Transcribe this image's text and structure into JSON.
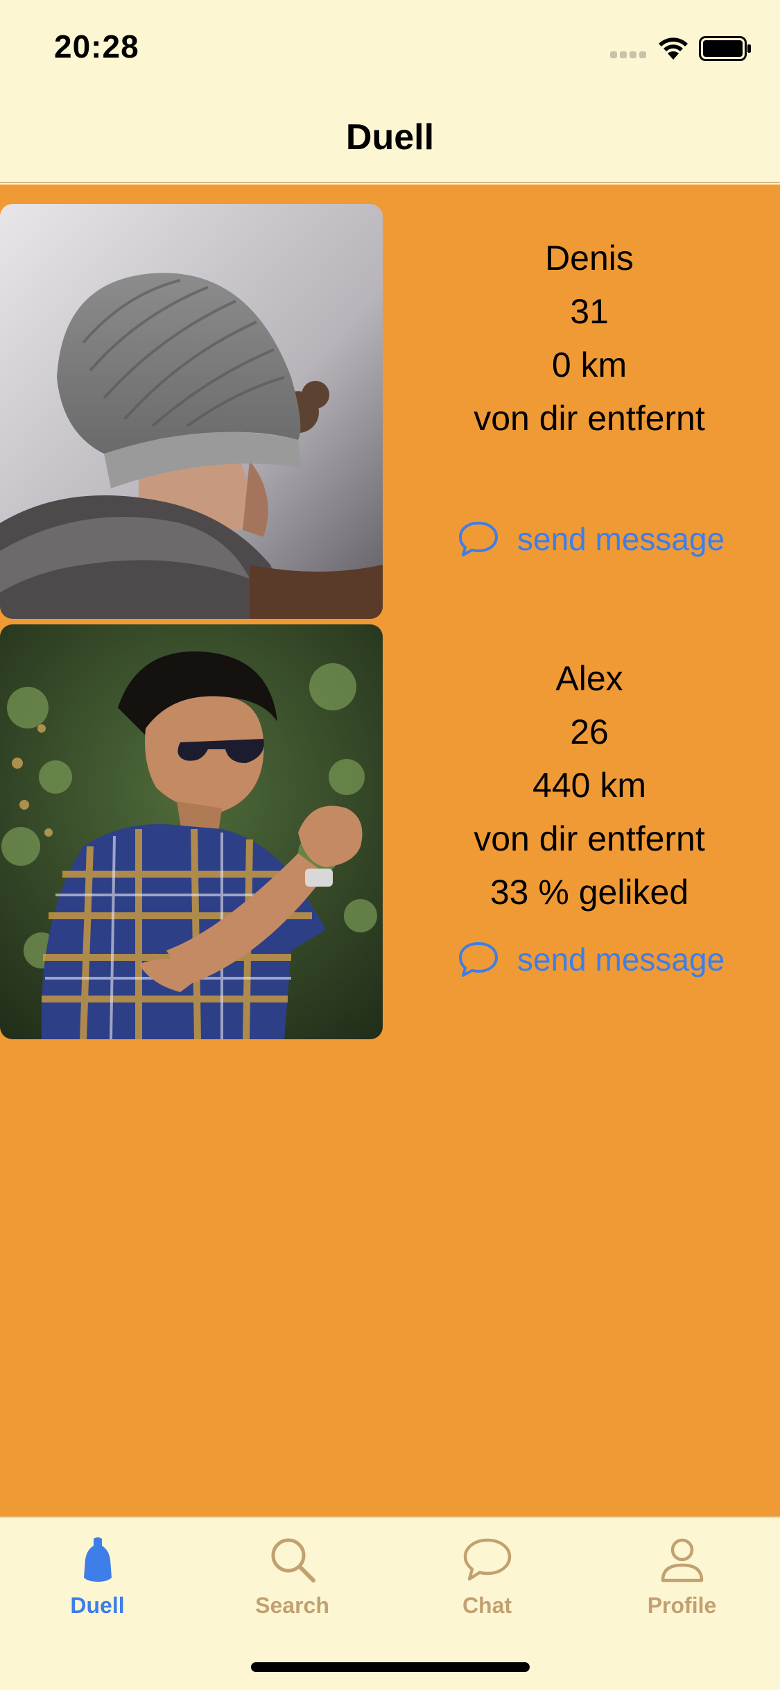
{
  "status_bar": {
    "time": "20:28"
  },
  "nav": {
    "title": "Duell"
  },
  "cards": [
    {
      "name": "Denis",
      "age": "31",
      "distance": "0 km",
      "distance_suffix": "von dir entfernt",
      "liked": "",
      "action_label": "send message",
      "action_icon": "chat-bubble-icon"
    },
    {
      "name": "Alex",
      "age": "26",
      "distance": "440 km",
      "distance_suffix": "von dir entfernt",
      "liked": "33 % geliked",
      "action_label": "send message",
      "action_icon": "chat-bubble-icon"
    }
  ],
  "tabs": [
    {
      "label": "Duell",
      "icon": "duell-figure-icon",
      "active": true
    },
    {
      "label": "Search",
      "icon": "magnifier-icon",
      "active": false
    },
    {
      "label": "Chat",
      "icon": "chat-bubble-icon",
      "active": false
    },
    {
      "label": "Profile",
      "icon": "person-icon",
      "active": false
    }
  ],
  "colors": {
    "background": "#fdf6d3",
    "content": "#f09a36",
    "accent": "#3d7ee8",
    "tab_inactive": "#c2a171"
  }
}
